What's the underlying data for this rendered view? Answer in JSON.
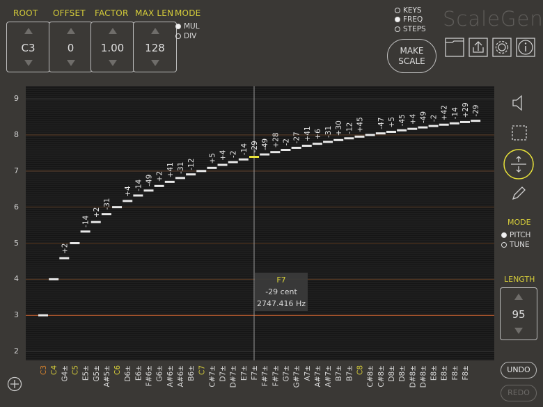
{
  "controls": {
    "root": {
      "label": "ROOT",
      "value": "C3"
    },
    "offset": {
      "label": "OFFSET",
      "value": "0"
    },
    "factor": {
      "label": "FACTOR",
      "value": "1.00"
    },
    "max_len": {
      "label": "MAX LEN",
      "value": "128"
    },
    "mode": {
      "label": "MODE",
      "options": [
        "MUL",
        "DIV"
      ],
      "selected": "MUL"
    }
  },
  "display_mode": {
    "options": [
      "KEYS",
      "FREQ",
      "STEPS"
    ],
    "selected": "FREQ"
  },
  "app_title": "ScaleGen",
  "make_scale": {
    "line1": "MAKE",
    "line2": "SCALE"
  },
  "toolbar_icons": [
    "folder-icon",
    "share-icon",
    "gear-icon",
    "info-icon"
  ],
  "plot": {
    "y_ticks": [
      "2",
      "3",
      "4",
      "5",
      "6",
      "7",
      "8",
      "9"
    ],
    "cursor_tooltip": {
      "note": "F7",
      "cent": "-29 cent",
      "freq": "2747.416 Hz"
    },
    "accent": "#e8e23a",
    "root_line_color": "#c8612d"
  },
  "chart_data": {
    "type": "scatter",
    "x_labels": [
      "C3",
      "C4",
      "G4±",
      "C5",
      "E5±",
      "G5±",
      "A#5±",
      "C6",
      "D6±",
      "E6±",
      "F#6±",
      "G6±",
      "A#6±",
      "A#6±",
      "B6±",
      "C7",
      "C#7±",
      "D7±",
      "D#7±",
      "E7±",
      "F7±",
      "F#7±",
      "F#7±",
      "G7±",
      "G#7±",
      "A7±",
      "A#7±",
      "A#7±",
      "B7±",
      "B7±",
      "C8",
      "C#8±",
      "C#8±",
      "D8±",
      "D8±",
      "D#8±",
      "D#8±",
      "E8±",
      "E8±",
      "F8±",
      "F8±"
    ],
    "cents": [
      "",
      "",
      "+2",
      "",
      "-14",
      "+2",
      "-31",
      "",
      "+4",
      "-14",
      "-49",
      "+2",
      "+41",
      "-31",
      "-12",
      "",
      "+5",
      "+4",
      "-2",
      "-14",
      "-29",
      "-49",
      "+28",
      "-2",
      "-27",
      "+41",
      "+6",
      "-31",
      "+30",
      "-12",
      "+45",
      "",
      "-47",
      "+5",
      "-45",
      "+4",
      "-49",
      "-2",
      "+42",
      "-14",
      "+29",
      "-29"
    ],
    "values": [
      3.0,
      4.0,
      4.585,
      5.0,
      5.322,
      5.585,
      5.807,
      6.0,
      6.17,
      6.322,
      6.459,
      6.585,
      6.7,
      6.807,
      6.907,
      7.0,
      7.087,
      7.17,
      7.248,
      7.322,
      7.392,
      7.459,
      7.524,
      7.585,
      7.644,
      7.7,
      7.755,
      7.807,
      7.858,
      7.907,
      7.954,
      8.0,
      8.044,
      8.087,
      8.129,
      8.17,
      8.209,
      8.248,
      8.285,
      8.322,
      8.358,
      8.392
    ],
    "highlight_index": 20,
    "ylim": [
      1.75,
      9.35
    ]
  },
  "side": {
    "mode_label": "MODE",
    "mode_options": [
      "PITCH",
      "TUNE"
    ],
    "mode_selected": "PITCH",
    "length_label": "LENGTH",
    "length_value": "95"
  },
  "buttons": {
    "undo": "UNDO",
    "redo": "REDO"
  }
}
